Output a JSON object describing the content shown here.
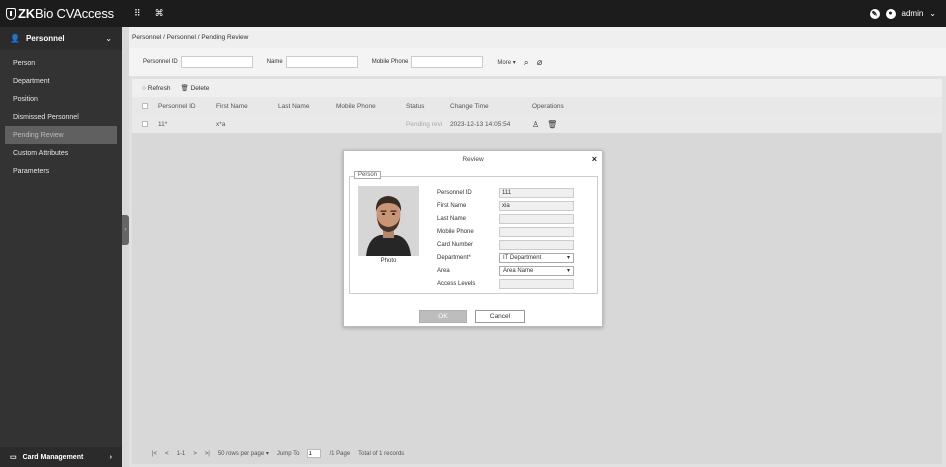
{
  "app": {
    "logo_prefix": "ZK",
    "logo_suffix": "Bio CVAccess"
  },
  "topbar": {
    "grid_icon": "⠿",
    "module_icon": "⌘",
    "user": "admin"
  },
  "sidebar": {
    "section": "Personnel",
    "items": [
      {
        "label": "Person"
      },
      {
        "label": "Department"
      },
      {
        "label": "Position"
      },
      {
        "label": "Dismissed Personnel"
      },
      {
        "label": "Pending Review"
      },
      {
        "label": "Custom Attributes"
      },
      {
        "label": "Parameters"
      }
    ],
    "footer": "Card Management"
  },
  "breadcrumb": "Personnel / Personnel / Pending Review",
  "filter": {
    "personnel_id_label": "Personnel ID",
    "name_label": "Name",
    "mobile_label": "Mobile Phone",
    "more_label": "More"
  },
  "toolbar": {
    "refresh": "Refresh",
    "delete": "Delete"
  },
  "table": {
    "headers": [
      "Personnel ID",
      "First Name",
      "Last Name",
      "Mobile Phone",
      "Status",
      "Change Time",
      "Operations"
    ],
    "rows": [
      {
        "id": "11*",
        "first": "x*a",
        "last": "",
        "mobile": "",
        "status": "Pending revi",
        "time": "2023-12-13 14:05:54"
      }
    ]
  },
  "pager": {
    "first": "|<",
    "prev": "<",
    "range": "1-1",
    "next": ">",
    "last": ">|",
    "rows_per_page": "50 rows per page",
    "jump_to": "Jump To",
    "page_value": "1",
    "page_total": "/1 Page",
    "total": "Total of 1 records"
  },
  "dialog": {
    "title": "Review",
    "legend": "Person",
    "photo_label": "Photo",
    "fields": {
      "personnel_id_label": "Personnel ID",
      "personnel_id_value": "111",
      "first_name_label": "First Name",
      "first_name_value": "xia",
      "last_name_label": "Last Name",
      "last_name_value": "",
      "mobile_label": "Mobile Phone",
      "mobile_value": "",
      "card_label": "Card Number",
      "card_value": "",
      "department_label": "Department*",
      "department_value": "IT Department",
      "area_label": "Area",
      "area_value": "Area Name",
      "access_label": "Access Levels",
      "access_value": ""
    },
    "ok": "OK",
    "cancel": "Cancel"
  }
}
